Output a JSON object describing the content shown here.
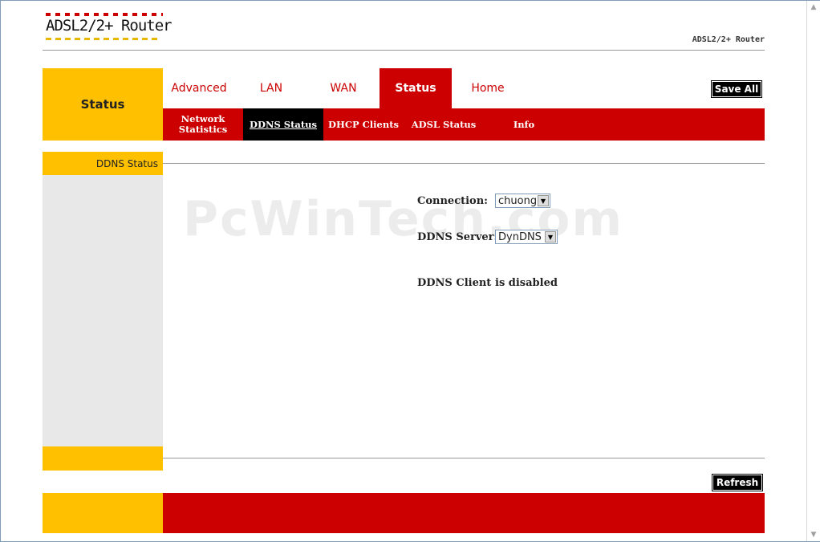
{
  "header": {
    "logo_text": "ADSL2/2+ Router",
    "product_name": "ADSL2/2+ Router"
  },
  "section_title": "Status",
  "main_tabs": [
    {
      "label": "Advanced"
    },
    {
      "label": "LAN"
    },
    {
      "label": "WAN"
    },
    {
      "label": "Status",
      "active": true
    },
    {
      "label": "Home"
    }
  ],
  "save_all_label": "Save All",
  "sub_nav": [
    {
      "label": "Network Statistics"
    },
    {
      "label": "DDNS Status",
      "active": true
    },
    {
      "label": "DHCP Clients"
    },
    {
      "label": "ADSL Status"
    },
    {
      "label": "Info"
    }
  ],
  "sidebar": {
    "heading": "DDNS Status"
  },
  "watermark": "PcWinTech.com",
  "form": {
    "connection_label": "Connection:",
    "connection_value": "chuong",
    "server_label": "DDNS Server:",
    "server_value": "DynDNS",
    "client_label": "DDNS Client",
    "client_status": "is disabled"
  },
  "refresh_label": "Refresh",
  "colors": {
    "accent_red": "#cc0000",
    "accent_yellow": "#ffc000"
  }
}
